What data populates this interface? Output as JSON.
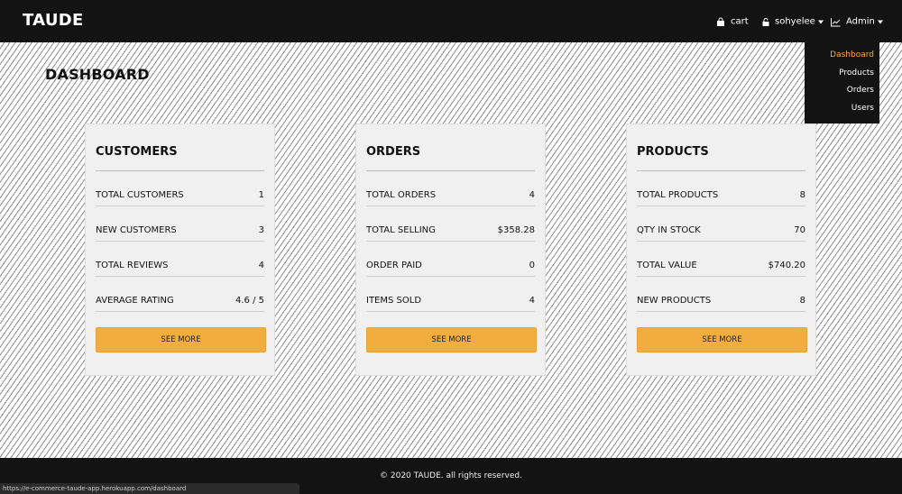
{
  "header": {
    "brand": "TAUDE",
    "cart_label": "cart",
    "user_label": "sohyelee",
    "admin_label": "Admin"
  },
  "admin_menu": {
    "items": [
      {
        "label": "Dashboard",
        "active": true
      },
      {
        "label": "Products",
        "active": false
      },
      {
        "label": "Orders",
        "active": false
      },
      {
        "label": "Users",
        "active": false
      }
    ]
  },
  "page": {
    "title": "DASHBOARD"
  },
  "cards": [
    {
      "title": "CUSTOMERS",
      "rows": [
        {
          "label": "TOTAL CUSTOMERS",
          "value": "1"
        },
        {
          "label": "NEW CUSTOMERS",
          "value": "3"
        },
        {
          "label": "TOTAL REVIEWS",
          "value": "4"
        },
        {
          "label": "AVERAGE RATING",
          "value": "4.6 / 5"
        }
      ],
      "button": "SEE MORE"
    },
    {
      "title": "ORDERS",
      "rows": [
        {
          "label": "TOTAL ORDERS",
          "value": "4"
        },
        {
          "label": "TOTAL SELLING",
          "value": "$358.28"
        },
        {
          "label": "ORDER PAID",
          "value": "0"
        },
        {
          "label": "ITEMS SOLD",
          "value": "4"
        }
      ],
      "button": "SEE MORE"
    },
    {
      "title": "PRODUCTS",
      "rows": [
        {
          "label": "TOTAL PRODUCTS",
          "value": "8"
        },
        {
          "label": "QTY IN STOCK",
          "value": "70"
        },
        {
          "label": "TOTAL VALUE",
          "value": "$740.20"
        },
        {
          "label": "NEW PRODUCTS",
          "value": "8"
        }
      ],
      "button": "SEE MORE"
    }
  ],
  "footer": {
    "text": "© 2020 TAUDE. all rights reserved."
  },
  "status_bar": {
    "url": "https://e-commerce-taude-app.herokuapp.com/dashboard"
  },
  "colors": {
    "accent": "#f2ad3f",
    "navbar": "#131313",
    "card": "#f0f0f0"
  },
  "icons": {
    "cart": "shopping-bag-icon",
    "user": "lock-icon",
    "admin": "chart-line-icon"
  }
}
